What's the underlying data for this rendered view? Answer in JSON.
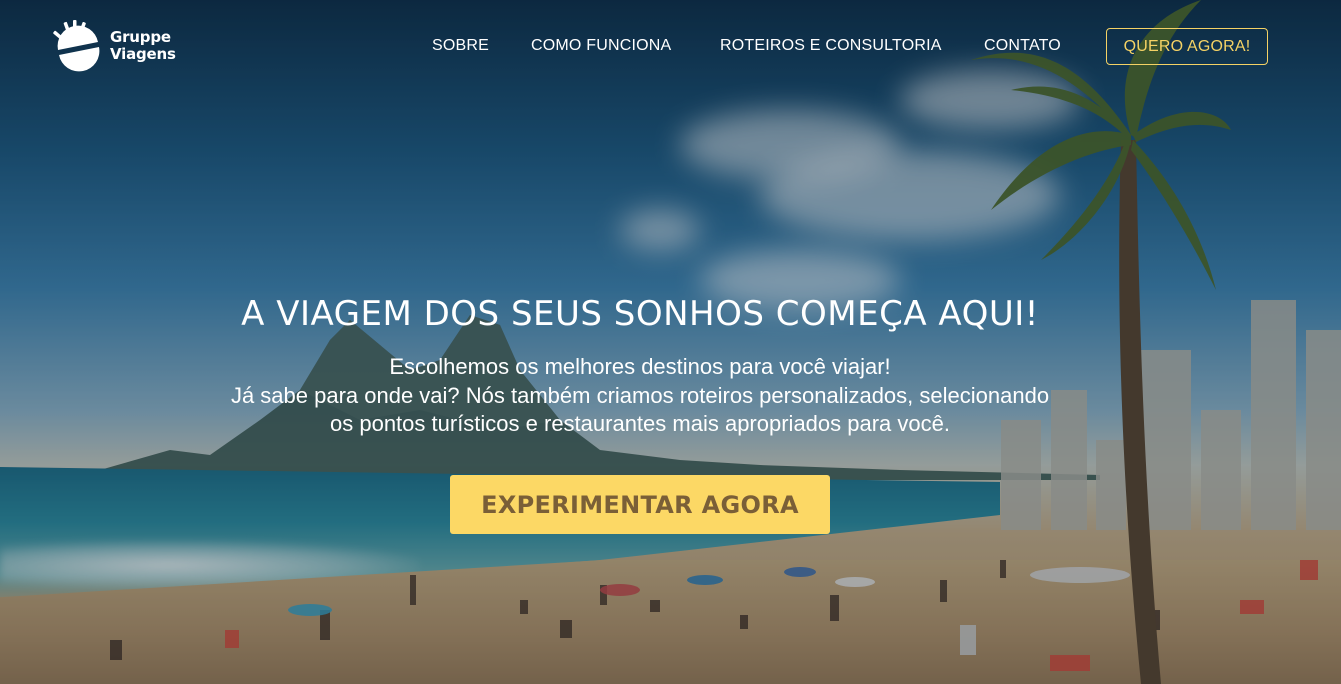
{
  "brand": {
    "line1": "Gruppe",
    "line2": "Viagens"
  },
  "nav": {
    "items": [
      "SOBRE",
      "COMO FUNCIONA",
      "ROTEIROS E CONSULTORIA",
      "CONTATO"
    ],
    "cta": "QUERO AGORA!"
  },
  "hero": {
    "title": "A VIAGEM DOS SEUS SONHOS COMEÇA AQUI!",
    "subtitle": [
      "Escolhemos os melhores destinos para você viajar!",
      "Já sabe para onde vai? Nós também criamos roteiros personalizados, selecionando",
      "os pontos turísticos e restaurantes mais apropriados para você."
    ],
    "button": "EXPERIMENTAR AGORA"
  },
  "colors": {
    "accent": "#fcd865",
    "accent_border": "#f4d265",
    "button_text": "#7a5f37"
  },
  "icons": {
    "logo": "sun-logo-icon"
  }
}
